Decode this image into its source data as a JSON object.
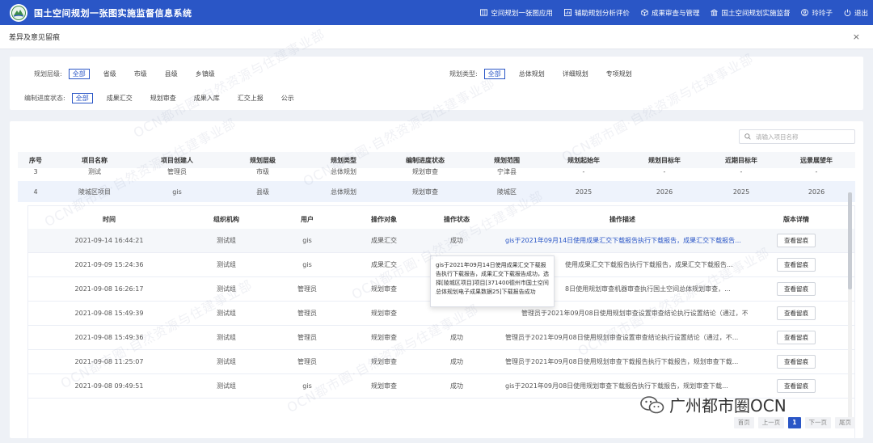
{
  "app": {
    "title": "国土空间规划一张图实施监督信息系统",
    "nav": [
      {
        "label": "空间规划一张图应用",
        "icon": "map-icon"
      },
      {
        "label": "辅助规划分析评价",
        "icon": "analysis-icon"
      },
      {
        "label": "成果审查与管理",
        "icon": "cube-icon"
      },
      {
        "label": "国土空间规划实施监督",
        "icon": "building-icon"
      },
      {
        "label": "玲玲子",
        "icon": "user-icon"
      },
      {
        "label": "退出",
        "icon": "power-icon"
      }
    ]
  },
  "panel": {
    "title": "差异及意见留痕",
    "close": "×"
  },
  "filters": {
    "level": {
      "label": "规划层级:",
      "options": [
        "全部",
        "省级",
        "市级",
        "县级",
        "乡镇级"
      ],
      "active": 0
    },
    "type": {
      "label": "规划类型:",
      "options": [
        "全部",
        "总体规划",
        "详细规划",
        "专项规划"
      ],
      "active": 0
    },
    "progress": {
      "label": "编制进度状态:",
      "options": [
        "全部",
        "成果汇交",
        "规划审查",
        "成果入库",
        "汇交上报",
        "公示"
      ],
      "active": 0
    }
  },
  "search": {
    "placeholder": "请输入项目名称"
  },
  "table": {
    "headers": [
      "序号",
      "项目名称",
      "项目创建人",
      "规划层级",
      "规划类型",
      "编制进度状态",
      "规划范围",
      "规划起始年",
      "规划目标年",
      "近期目标年",
      "远景展望年"
    ],
    "rows": [
      [
        "3",
        "测试",
        "管理员",
        "市级",
        "总体规划",
        "规划审查",
        "宁津县",
        "-",
        "-",
        "-",
        "-"
      ],
      [
        "4",
        "陵城区项目",
        "gis",
        "县级",
        "总体规划",
        "规划审查",
        "陵城区",
        "2025",
        "2026",
        "2025",
        "2026"
      ]
    ]
  },
  "logs": {
    "headers": [
      "时间",
      "组织机构",
      "用户",
      "操作对象",
      "操作状态",
      "操作描述",
      "版本详情"
    ],
    "button": "查看留痕",
    "rows": [
      {
        "time": "2021-09-14 16:44:21",
        "org": "测试组",
        "user": "gis",
        "object": "成果汇交",
        "status": "成功",
        "desc": "gis于2021年09月14日使用成果汇交下载报告执行下载报告，成果汇交下载报告..."
      },
      {
        "time": "2021-09-09 15:24:36",
        "org": "测试组",
        "user": "gis",
        "object": "成果汇交",
        "status": "",
        "desc": "使用成果汇交下载报告执行下载报告，成果汇交下载报告..."
      },
      {
        "time": "2021-09-08 16:26:17",
        "org": "测试组",
        "user": "管理员",
        "object": "规划审查",
        "status": "",
        "desc": "8日使用规划审查机器审查执行国土空间总体规划审查，..."
      },
      {
        "time": "2021-09-08 15:49:39",
        "org": "测试组",
        "user": "管理员",
        "object": "规划审查",
        "status": "",
        "desc": "管理员于2021年09月08日使用规划审查设置审查结论执行设置结论（通过，不..."
      },
      {
        "time": "2021-09-08 15:49:36",
        "org": "测试组",
        "user": "管理员",
        "object": "规划审查",
        "status": "成功",
        "desc": "管理员于2021年09月08日使用规划审查设置审查结论执行设置结论（通过，不..."
      },
      {
        "time": "2021-09-08 11:25:07",
        "org": "测试组",
        "user": "管理员",
        "object": "规划审查",
        "status": "成功",
        "desc": "管理员于2021年09月08日使用规划审查下载报告执行下载报告，规划审查下载..."
      },
      {
        "time": "2021-09-08 09:49:51",
        "org": "测试组",
        "user": "gis",
        "object": "规划审查",
        "status": "成功",
        "desc": "gis于2021年09月08日使用规划审查下载报告执行下载报告，规划审查下载..."
      }
    ]
  },
  "tooltip": {
    "text": "gis于2021年09月14日使用成果汇交下载报告执行下载报告，成果汇交下载报告成功，选择[陵城区项目]项目[371400德州市国土空间总体规划电子成果数据25]下载报告成功"
  },
  "pagination": {
    "first": "首页",
    "prev": "上一页",
    "current": "1",
    "next": "下一页",
    "last": "尾页"
  },
  "watermark": {
    "text": "OCN都市圈·自然资源与住建事业部"
  },
  "brand": {
    "text": "广州都市圈OCN"
  },
  "colors": {
    "primary": "#2a56c6",
    "link": "#2a56c6"
  }
}
